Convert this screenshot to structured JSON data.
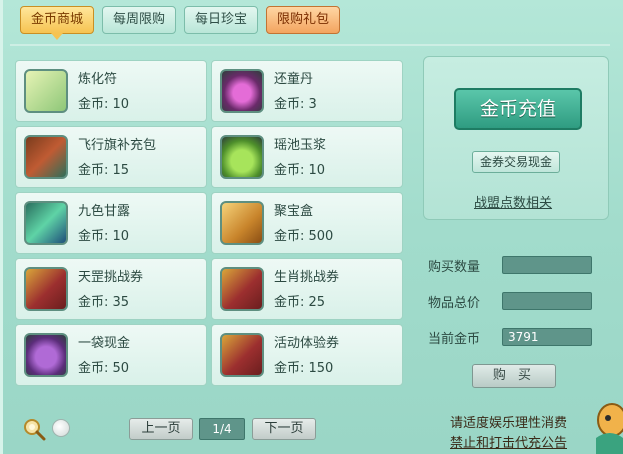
{
  "tabs": [
    {
      "label": "金币商城",
      "active": true
    },
    {
      "label": "每周限购",
      "active": false
    },
    {
      "label": "每日珍宝",
      "active": false
    },
    {
      "label": "限购礼包",
      "active": false
    }
  ],
  "items": [
    {
      "name": "炼化符",
      "price": "金币: 10",
      "icon": "talisman-icon"
    },
    {
      "name": "还童丹",
      "price": "金币: 3",
      "icon": "pill-icon"
    },
    {
      "name": "飞行旗补充包",
      "price": "金币: 15",
      "icon": "flag-pack-icon"
    },
    {
      "name": "瑶池玉浆",
      "price": "金币: 10",
      "icon": "jade-jar-icon"
    },
    {
      "name": "九色甘露",
      "price": "金币: 10",
      "icon": "dew-bottle-icon"
    },
    {
      "name": "聚宝盒",
      "price": "金币: 500",
      "icon": "treasure-box-icon"
    },
    {
      "name": "天罡挑战券",
      "price": "金币: 35",
      "icon": "scroll-icon"
    },
    {
      "name": "生肖挑战券",
      "price": "金币: 25",
      "icon": "scroll-icon"
    },
    {
      "name": "一袋现金",
      "price": "金币: 50",
      "icon": "money-bag-icon"
    },
    {
      "name": "活动体验券",
      "price": "金币: 150",
      "icon": "scroll-icon"
    }
  ],
  "side": {
    "recharge_label": "金币充值",
    "exchange_label": "金券交易现金",
    "alliance_link": "战盟点数相关"
  },
  "purchase": {
    "quantity_label": "购买数量",
    "quantity_value": "",
    "total_label": "物品总价",
    "total_value": "",
    "current_label": "当前金币",
    "current_value": "3791",
    "buy_label": "购 买"
  },
  "pager": {
    "prev_label": "上一页",
    "page": "1/4",
    "next_label": "下一页"
  },
  "notice": {
    "line1": "请适度娱乐理性消费",
    "line2": "禁止和打击代充公告"
  },
  "colors": {
    "accent": "#2f9c81",
    "tab_active": "#f6c351",
    "background": "#a3dccd"
  }
}
